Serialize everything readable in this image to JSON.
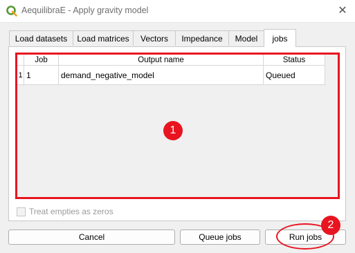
{
  "window": {
    "title": "AequilibraE - Apply gravity model",
    "close_glyph": "✕",
    "icon": "qgis-logo"
  },
  "tabs": [
    {
      "label": "Load datasets",
      "active": false
    },
    {
      "label": "Load matrices",
      "active": false
    },
    {
      "label": "Vectors",
      "active": false
    },
    {
      "label": "Impedance",
      "active": false
    },
    {
      "label": "Model",
      "active": false
    },
    {
      "label": "jobs",
      "active": true
    }
  ],
  "jobs_table": {
    "columns": [
      "Job",
      "Output name",
      "Status"
    ],
    "rows": [
      {
        "row_header": "1",
        "job": "1",
        "output_name": "demand_negative_model",
        "status": "Queued"
      }
    ]
  },
  "treat_empties": {
    "label": "Treat empties as zeros",
    "checked": false,
    "enabled": false
  },
  "buttons": {
    "cancel": "Cancel",
    "queue_jobs": "Queue jobs",
    "run_jobs": "Run jobs"
  },
  "annotations": [
    {
      "label": "1",
      "color": "#e8141f"
    },
    {
      "label": "2",
      "color": "#e8141f"
    }
  ]
}
